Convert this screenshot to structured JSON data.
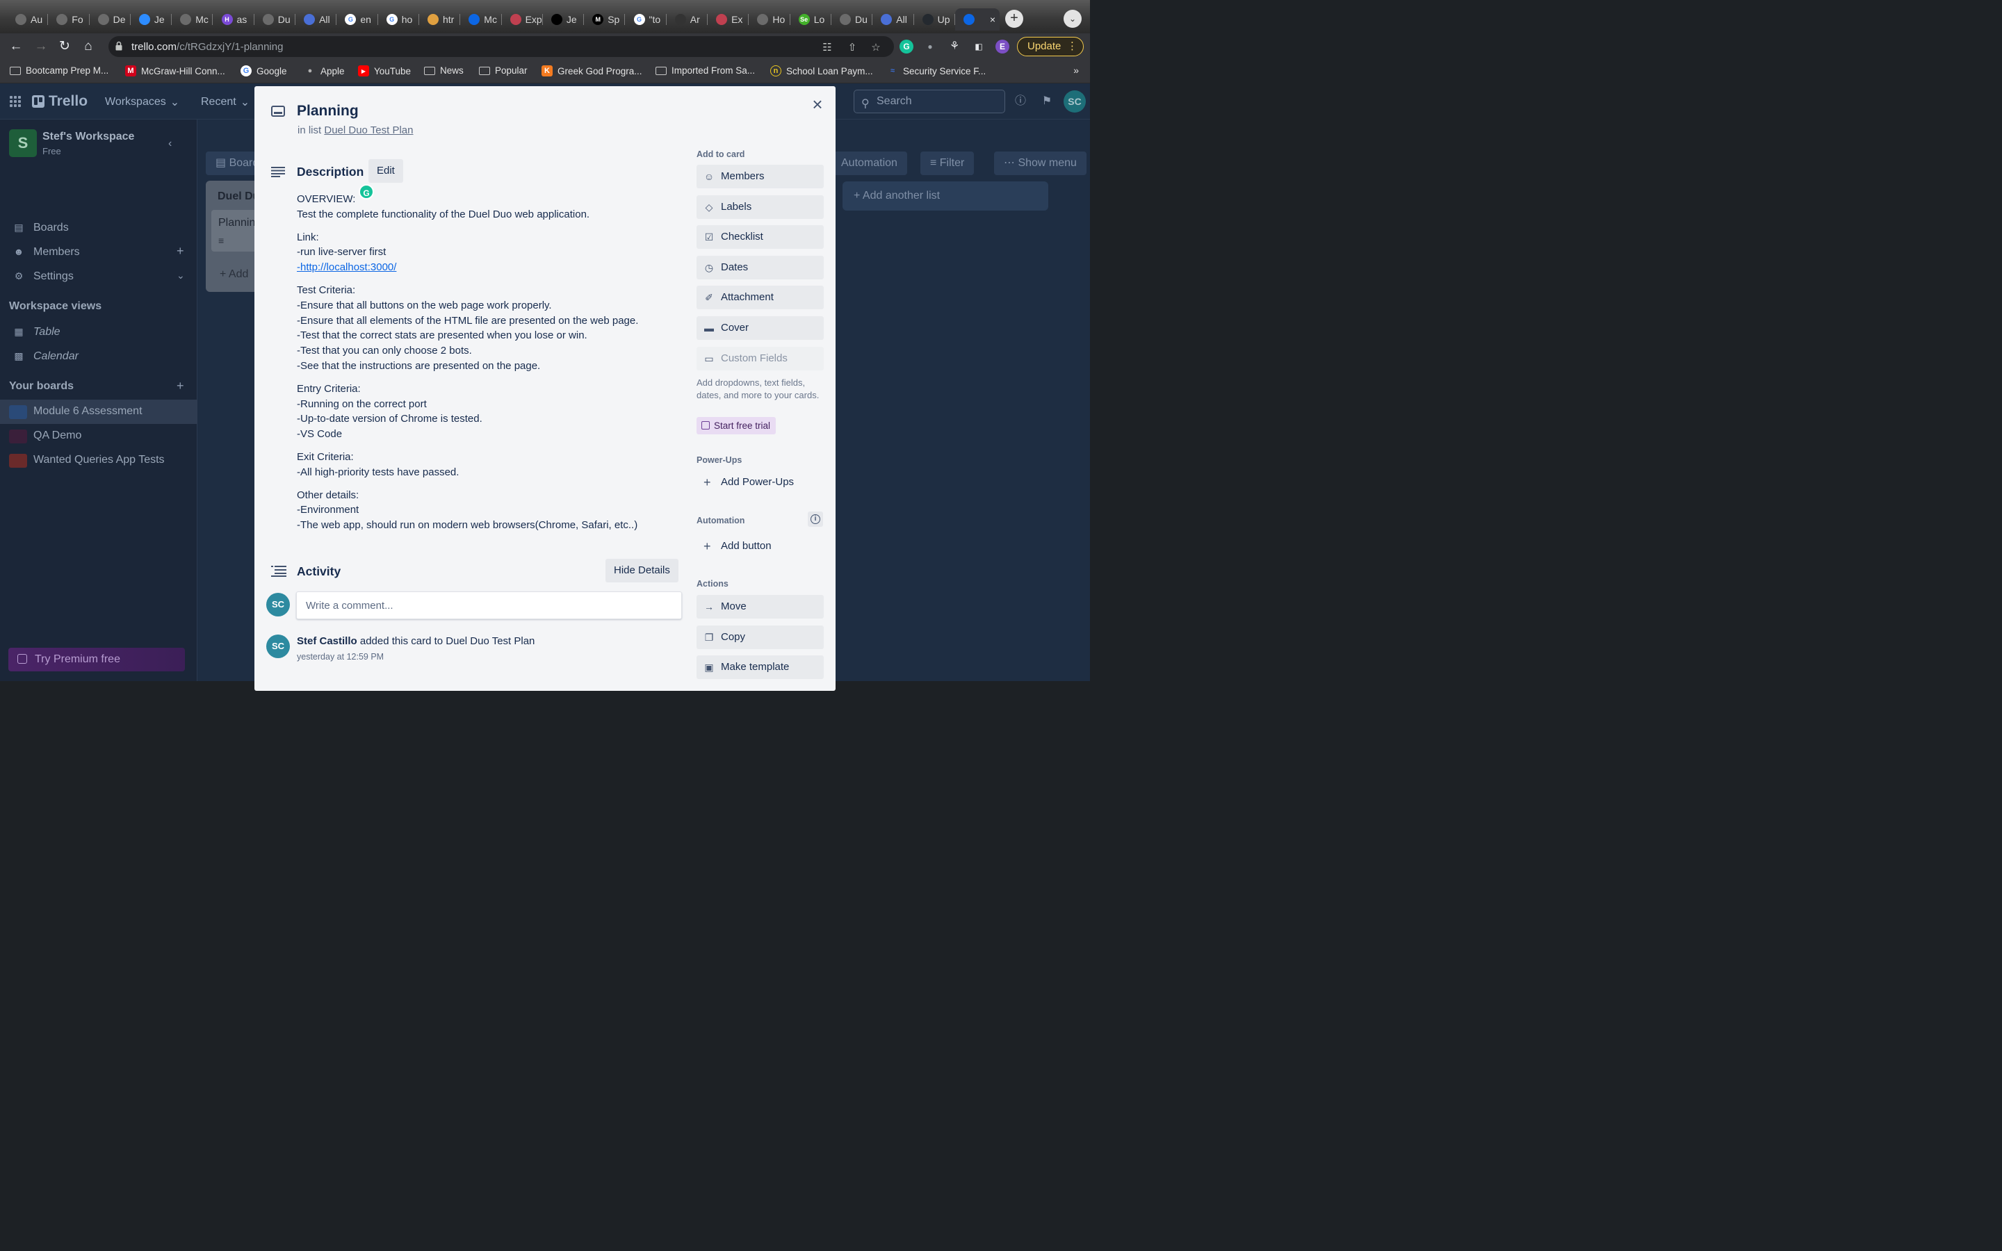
{
  "browser": {
    "tabs": [
      {
        "label": "Au",
        "fav_color": "#6b6b6b",
        "glyph": ""
      },
      {
        "label": "Fo",
        "fav_color": "#6b6b6b",
        "glyph": ""
      },
      {
        "label": "De",
        "fav_color": "#6b6b6b",
        "glyph": ""
      },
      {
        "label": "Je",
        "fav_color": "#2d8cff",
        "glyph": ""
      },
      {
        "label": "Mc",
        "fav_color": "#6b6b6b",
        "glyph": ""
      },
      {
        "label": "as",
        "fav_color": "#7b4bd6",
        "glyph": "H"
      },
      {
        "label": "Du",
        "fav_color": "#6b6b6b",
        "glyph": ""
      },
      {
        "label": "All",
        "fav_color": "#4a6fd6",
        "glyph": ""
      },
      {
        "label": "en",
        "fav_color": "#ffffff",
        "glyph": "G"
      },
      {
        "label": "ho",
        "fav_color": "#ffffff",
        "glyph": "G"
      },
      {
        "label": "htr",
        "fav_color": "#e0a040",
        "glyph": ""
      },
      {
        "label": "Mc",
        "fav_color": "#0c66e4",
        "glyph": ""
      },
      {
        "label": "Exp",
        "fav_color": "#c04050",
        "glyph": ""
      },
      {
        "label": "Je",
        "fav_color": "#000000",
        "glyph": ""
      },
      {
        "label": "Sp",
        "fav_color": "#000000",
        "glyph": "M"
      },
      {
        "label": "\"to",
        "fav_color": "#ffffff",
        "glyph": "G"
      },
      {
        "label": "Ar",
        "fav_color": "#333333",
        "glyph": ""
      },
      {
        "label": "Ex",
        "fav_color": "#c04050",
        "glyph": ""
      },
      {
        "label": "Ho",
        "fav_color": "#6b6b6b",
        "glyph": ""
      },
      {
        "label": "Lo",
        "fav_color": "#43b02a",
        "glyph": "Se"
      },
      {
        "label": "Du",
        "fav_color": "#6b6b6b",
        "glyph": ""
      },
      {
        "label": "All",
        "fav_color": "#4a6fd6",
        "glyph": ""
      },
      {
        "label": "Up",
        "fav_color": "#24292f",
        "glyph": ""
      },
      {
        "label": "",
        "fav_color": "#0c66e4",
        "glyph": "",
        "active": true
      }
    ],
    "url_host": "trello.com",
    "url_path": "/c/tRGdzxjY/1-planning",
    "update_label": "Update",
    "profile_letter": "E",
    "bookmarks": [
      {
        "label": "Bootcamp Prep M...",
        "icon": "folder"
      },
      {
        "label": "McGraw-Hill Conn...",
        "icon": "M",
        "color": "#d0021b"
      },
      {
        "label": "Google",
        "icon": "G",
        "color": "#ffffff"
      },
      {
        "label": "Apple",
        "icon": "apple",
        "color": "#b0b0b0"
      },
      {
        "label": "YouTube",
        "icon": "yt",
        "color": "#ff0000"
      },
      {
        "label": "News",
        "icon": "folder"
      },
      {
        "label": "Popular",
        "icon": "folder"
      },
      {
        "label": "Greek God Progra...",
        "icon": "K",
        "color": "#f47b20"
      },
      {
        "label": "Imported From Sa...",
        "icon": "folder"
      },
      {
        "label": "School Loan Paym...",
        "icon": "n",
        "color": "#e8c520"
      },
      {
        "label": "Security Service F...",
        "icon": "ssf",
        "color": "#3a6fd6"
      }
    ],
    "bookmarks_more": "»"
  },
  "trello": {
    "logo": "Trello",
    "menus": [
      "Workspaces",
      "Recent"
    ],
    "search_placeholder": "Search",
    "avatar": "SC",
    "workspace": {
      "badge": "S",
      "name": "Stef's Workspace",
      "plan": "Free"
    },
    "nav": [
      "Boards",
      "Members",
      "Settings"
    ],
    "views_heading": "Workspace views",
    "views": [
      "Table",
      "Calendar"
    ],
    "boards_heading": "Your boards",
    "boards": [
      {
        "name": "Module 6 Assessment",
        "color": "#2a4a78"
      },
      {
        "name": "QA Demo",
        "color": "#3a1f3a"
      },
      {
        "name": "Wanted Queries App Tests",
        "color": "#6a2a2a"
      }
    ],
    "premium": "Try Premium free",
    "board_chip": "Board",
    "list_title": "Duel Du",
    "list_card": "Plannin",
    "list_add": "+ Add",
    "toolbar": {
      "automation": "Automation",
      "filter": "Filter",
      "show_menu": "Show menu"
    },
    "add_list": "+ Add another list"
  },
  "card": {
    "title": "Planning",
    "in_list_prefix": "in list",
    "list_name": "Duel Duo Test Plan",
    "description_heading": "Description",
    "edit_label": "Edit",
    "description": {
      "overview_title": "OVERVIEW:",
      "overview": "Test the complete functionality of the Duel Duo web application.",
      "link_title": "Link:",
      "link_note": "-run live-server first",
      "link_url": "-http://localhost:3000/",
      "test_title": "Test Criteria:",
      "test": [
        "-Ensure that all buttons on the web page work properly.",
        "-Ensure that all elements of the HTML file are presented on the web page.",
        "-Test that the correct stats are presented when you lose or win.",
        "-Test that you can only choose 2 bots.",
        "-See that the instructions are presented on the page."
      ],
      "entry_title": "Entry Criteria:",
      "entry": [
        "-Running on the correct port",
        "-Up-to-date version of Chrome is tested.",
        "-VS Code"
      ],
      "exit_title": "Exit Criteria:",
      "exit": [
        "-All high-priority tests have passed."
      ],
      "other_title": "Other details:",
      "other": [
        "-Environment",
        "-The web app, should run on modern web browsers(Chrome, Safari, etc..)"
      ]
    },
    "activity_heading": "Activity",
    "hide_details": "Hide Details",
    "comment_placeholder": "Write a comment...",
    "user_initials": "SC",
    "activity": {
      "user": "Stef Castillo",
      "action": " added this card to Duel Duo Test Plan",
      "time": "yesterday at 12:59 PM"
    },
    "sidebar": {
      "add_heading": "Add to card",
      "add": [
        "Members",
        "Labels",
        "Checklist",
        "Dates",
        "Attachment",
        "Cover",
        "Custom Fields"
      ],
      "custom_note": "Add dropdowns, text fields, dates, and more to your cards.",
      "trial": "Start free trial",
      "powerups_heading": "Power-Ups",
      "add_powerups": "Add Power-Ups",
      "automation_heading": "Automation",
      "add_button": "Add button",
      "actions_heading": "Actions",
      "actions": [
        "Move",
        "Copy",
        "Make template"
      ]
    }
  }
}
